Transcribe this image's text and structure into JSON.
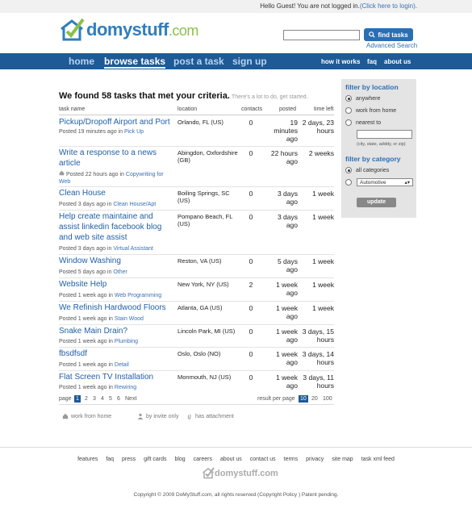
{
  "topbar": {
    "greeting": "Hello Guest! You are not logged in.",
    "login_link": "(Click here to login)",
    "end": "."
  },
  "logo": {
    "word": "domystuff",
    "suffix": ".com"
  },
  "search": {
    "value": "",
    "button": "find tasks",
    "advanced": "Advanced Search"
  },
  "nav": {
    "tabs": [
      "home",
      "browse tasks",
      "post a task",
      "sign up"
    ],
    "active": "browse tasks",
    "right": [
      "how it works",
      "faq",
      "about us"
    ]
  },
  "results": {
    "headline": "We found 58 tasks that met your criteria.",
    "sub": "There's a lot to do, get started."
  },
  "columns": [
    "task name",
    "location",
    "contacts",
    "posted",
    "time left"
  ],
  "tasks": [
    {
      "name": "Pickup/Dropoff Airport and Port",
      "meta": "Posted 19 minutes ago in ",
      "category": "Pick Up",
      "location": "Orlando, FL (US)",
      "contacts": "0",
      "posted": "19 minutes ago",
      "timeleft": "2 days, 23 hours"
    },
    {
      "name": "Write a response to a news article",
      "meta": "Posted 22 hours ago in ",
      "category": "Copywriting for Web",
      "location": "Abingdon, Oxfordshire (GB)",
      "contacts": "0",
      "posted": "22 hours ago",
      "timeleft": "2 weeks"
    },
    {
      "name": "Clean House",
      "meta": "Posted 3 days ago in ",
      "category": "Clean House/Apt",
      "location": "Boiling Springs, SC (US)",
      "contacts": "0",
      "posted": "3 days ago",
      "timeleft": "1 week"
    },
    {
      "name": "Help create maintaine and assist linkedin facebook blog and web site assist",
      "meta": "Posted 3 days ago in ",
      "category": "Virtual Assistant",
      "location": "Pompano Beach, FL (US)",
      "contacts": "0",
      "posted": "3 days ago",
      "timeleft": "1 week"
    },
    {
      "name": "Window Washing",
      "meta": "Posted 5 days ago in ",
      "category": "Other",
      "location": "Reston, VA (US)",
      "contacts": "0",
      "posted": "5 days ago",
      "timeleft": "1 week"
    },
    {
      "name": "Website Help",
      "meta": "Posted 1 week ago in ",
      "category": "Web Programming",
      "location": "New York, NY (US)",
      "contacts": "2",
      "posted": "1 week ago",
      "timeleft": "1 week"
    },
    {
      "name": "We Refinish Hardwood Floors",
      "meta": "Posted 1 week ago in ",
      "category": "Stain Wood",
      "location": "Atlanta, GA (US)",
      "contacts": "0",
      "posted": "1 week ago",
      "timeleft": "1 week"
    },
    {
      "name": "Snake Main Drain?",
      "meta": "Posted 1 week ago in ",
      "category": "Plumbing",
      "location": "Lincoln Park, MI (US)",
      "contacts": "0",
      "posted": "1 week ago",
      "timeleft": "3 days, 15 hours"
    },
    {
      "name": "fbsdfsdf",
      "meta": "Posted 1 week ago in ",
      "category": "Detail",
      "location": "Oslo, Oslo (NO)",
      "contacts": "0",
      "posted": "1 week ago",
      "timeleft": "3 days, 14 hours"
    },
    {
      "name": "Flat Screen TV Installation",
      "meta": "Posted 1 week ago in ",
      "category": "Rewiring",
      "location": "Monmouth, NJ (US)",
      "contacts": "0",
      "posted": "1 week ago",
      "timeleft": "3 days, 11 hours"
    }
  ],
  "pager": {
    "label": "page",
    "pages": [
      "1",
      "2",
      "3",
      "4",
      "5",
      "6"
    ],
    "next": "Next",
    "per_page_label": "result per page",
    "per_page": [
      "10",
      "20",
      "100"
    ],
    "current_page": "1",
    "current_per_page": "10"
  },
  "legend": [
    "work from home",
    "by invite only",
    "has attachment"
  ],
  "sidebar": {
    "location_title": "filter by location",
    "location_options": [
      "anywhere",
      "work from home",
      "nearest to"
    ],
    "zip_hint": "(city, state, adddy, or zip)",
    "category_title": "filter by category",
    "category_options": [
      "all categories"
    ],
    "category_select": "Automotive",
    "update": "update"
  },
  "footer": {
    "links": [
      "features",
      "faq",
      "press",
      "gift cards",
      "blog",
      "careers",
      "about us",
      "contact us",
      "terms",
      "privacy",
      "site map",
      "task xml feed"
    ],
    "logo": "domystuff.com",
    "copyright": "Copyright © 2009 DoMyStuff.com, all rights reserved (Copyright Policy  ) Patent pending."
  },
  "colors": {
    "brand_blue": "#1e5a96",
    "link": "#1f5fa8",
    "logo_green": "#8bbf4a"
  }
}
